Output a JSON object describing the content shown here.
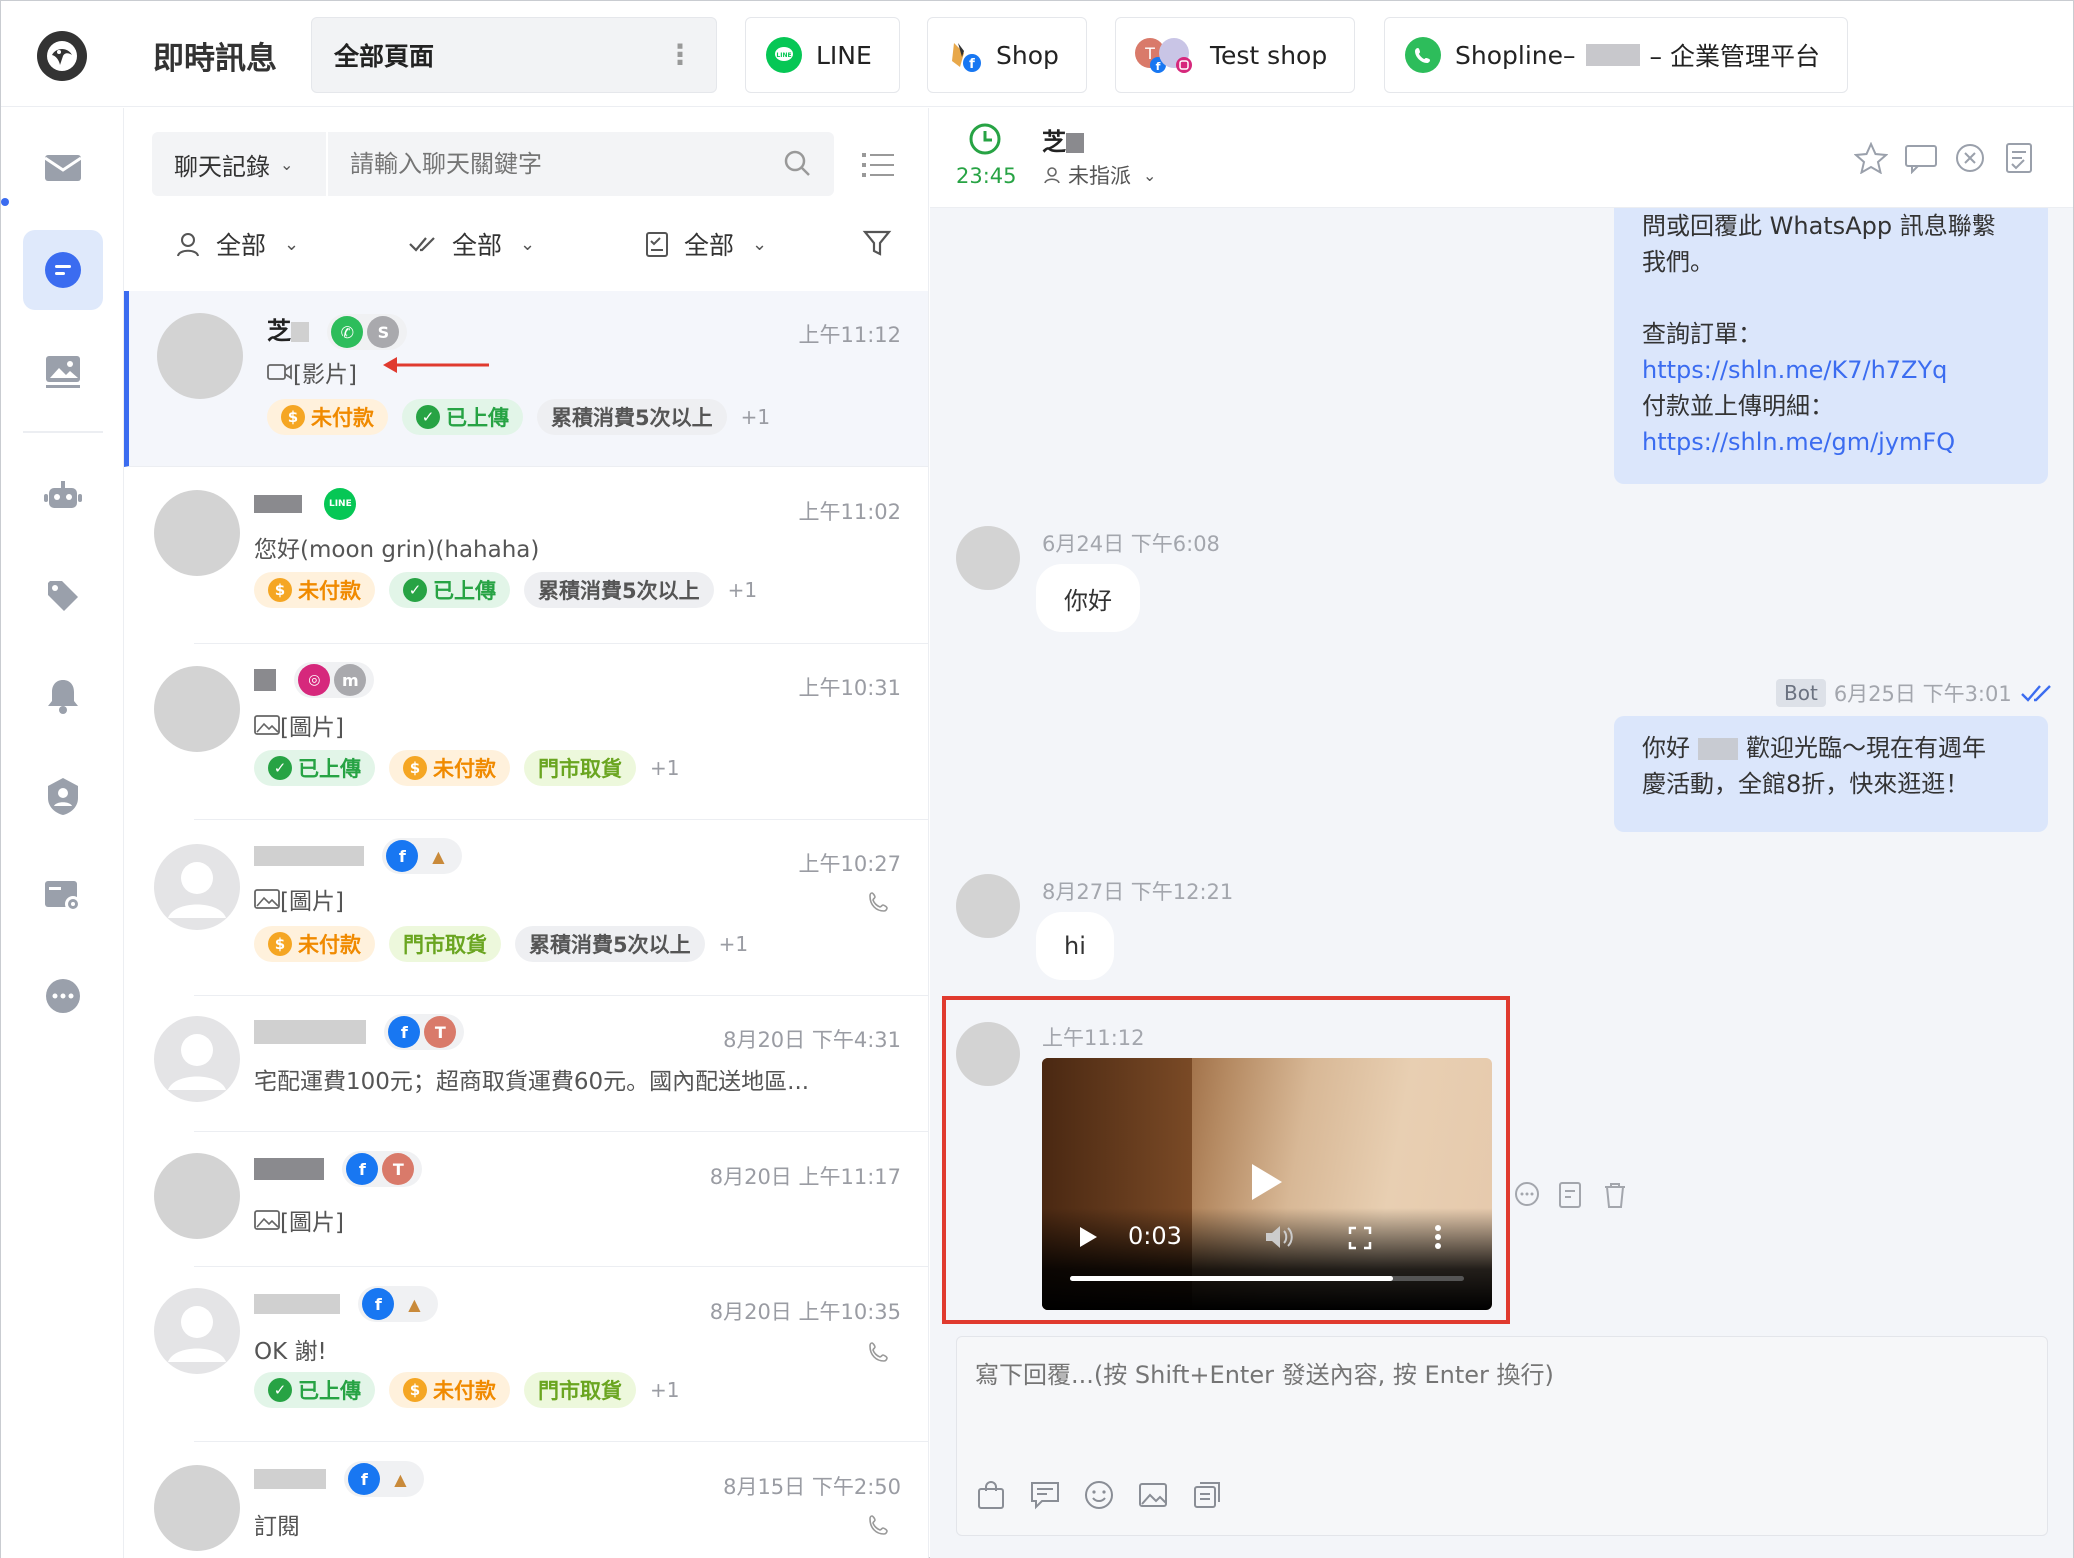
{
  "app": {
    "title": "即時訊息"
  },
  "tabs": [
    {
      "label": "全部頁面"
    },
    {
      "label": "LINE"
    },
    {
      "label": "Shop"
    },
    {
      "label": "Test shop"
    },
    {
      "label_prefix": "Shopline–",
      "label_suffix": "– 企業管理平台"
    }
  ],
  "search": {
    "scope": "聊天記錄",
    "placeholder": "請輸入聊天關鍵字"
  },
  "filters": {
    "assignee": "全部",
    "status": "全部",
    "type": "全部"
  },
  "conversations": [
    {
      "name": "芝",
      "preview": "[影片]",
      "time": "上午11:12",
      "tags": [
        "未付款",
        "已上傳",
        "累積消費5次以上"
      ],
      "more": "+1"
    },
    {
      "name": "",
      "preview": "您好(moon grin)(hahaha)",
      "time": "上午11:02",
      "tags": [
        "未付款",
        "已上傳",
        "累積消費5次以上"
      ],
      "more": "+1"
    },
    {
      "name": "",
      "preview": "[圖片]",
      "time": "上午10:31",
      "tags": [
        "已上傳",
        "未付款",
        "門市取貨"
      ],
      "more": "+1"
    },
    {
      "name": "",
      "preview": "[圖片]",
      "time": "上午10:27",
      "tags": [
        "未付款",
        "門市取貨",
        "累積消費5次以上"
      ],
      "more": "+1"
    },
    {
      "name": "",
      "preview": "宅配運費100元；超商取貨運費60元。國內配送地區...",
      "time": "8月20日 下午4:31"
    },
    {
      "name": "",
      "preview": "[圖片]",
      "time": "8月20日 上午11:17"
    },
    {
      "name": "",
      "preview": "OK 謝!",
      "time": "8月20日 上午10:35",
      "tags": [
        "已上傳",
        "未付款",
        "門市取貨"
      ],
      "more": "+1"
    },
    {
      "name": "",
      "preview": "訂閱",
      "time": "8月15日 下午2:50"
    }
  ],
  "chat": {
    "timer": "23:45",
    "name": "芝",
    "assign": "未指派",
    "msg_top": {
      "line1": "問或回覆此 WhatsApp 訊息聯繫",
      "line2": "我們。",
      "line3": "查詢訂單：",
      "link1": "https://shln.me/K7/h7ZYq",
      "line4": "付款並上傳明細：",
      "link2": "https://shln.me/gm/jymFQ"
    },
    "msg1": {
      "time": "6月24日 下午6:08",
      "text": "你好"
    },
    "msg2": {
      "badge": "Bot",
      "time": "6月25日 下午3:01",
      "text_a": "你好",
      "text_b": "歡迎光臨～現在有週年",
      "text_c": "慶活動，全館8折，快來逛逛！"
    },
    "msg3": {
      "time": "8月27日 下午12:21",
      "text": "hi"
    },
    "msg4": {
      "time": "上午11:12",
      "video_time": "0:03",
      "video_progress": 0.82
    },
    "reply_placeholder": "寫下回覆...(按 Shift+Enter 發送內容, 按 Enter 換行)"
  },
  "colors": {
    "accent": "#3b6cf0",
    "line_green": "#06c755",
    "facebook": "#1877f2",
    "highlight_red": "#e03a2f"
  }
}
